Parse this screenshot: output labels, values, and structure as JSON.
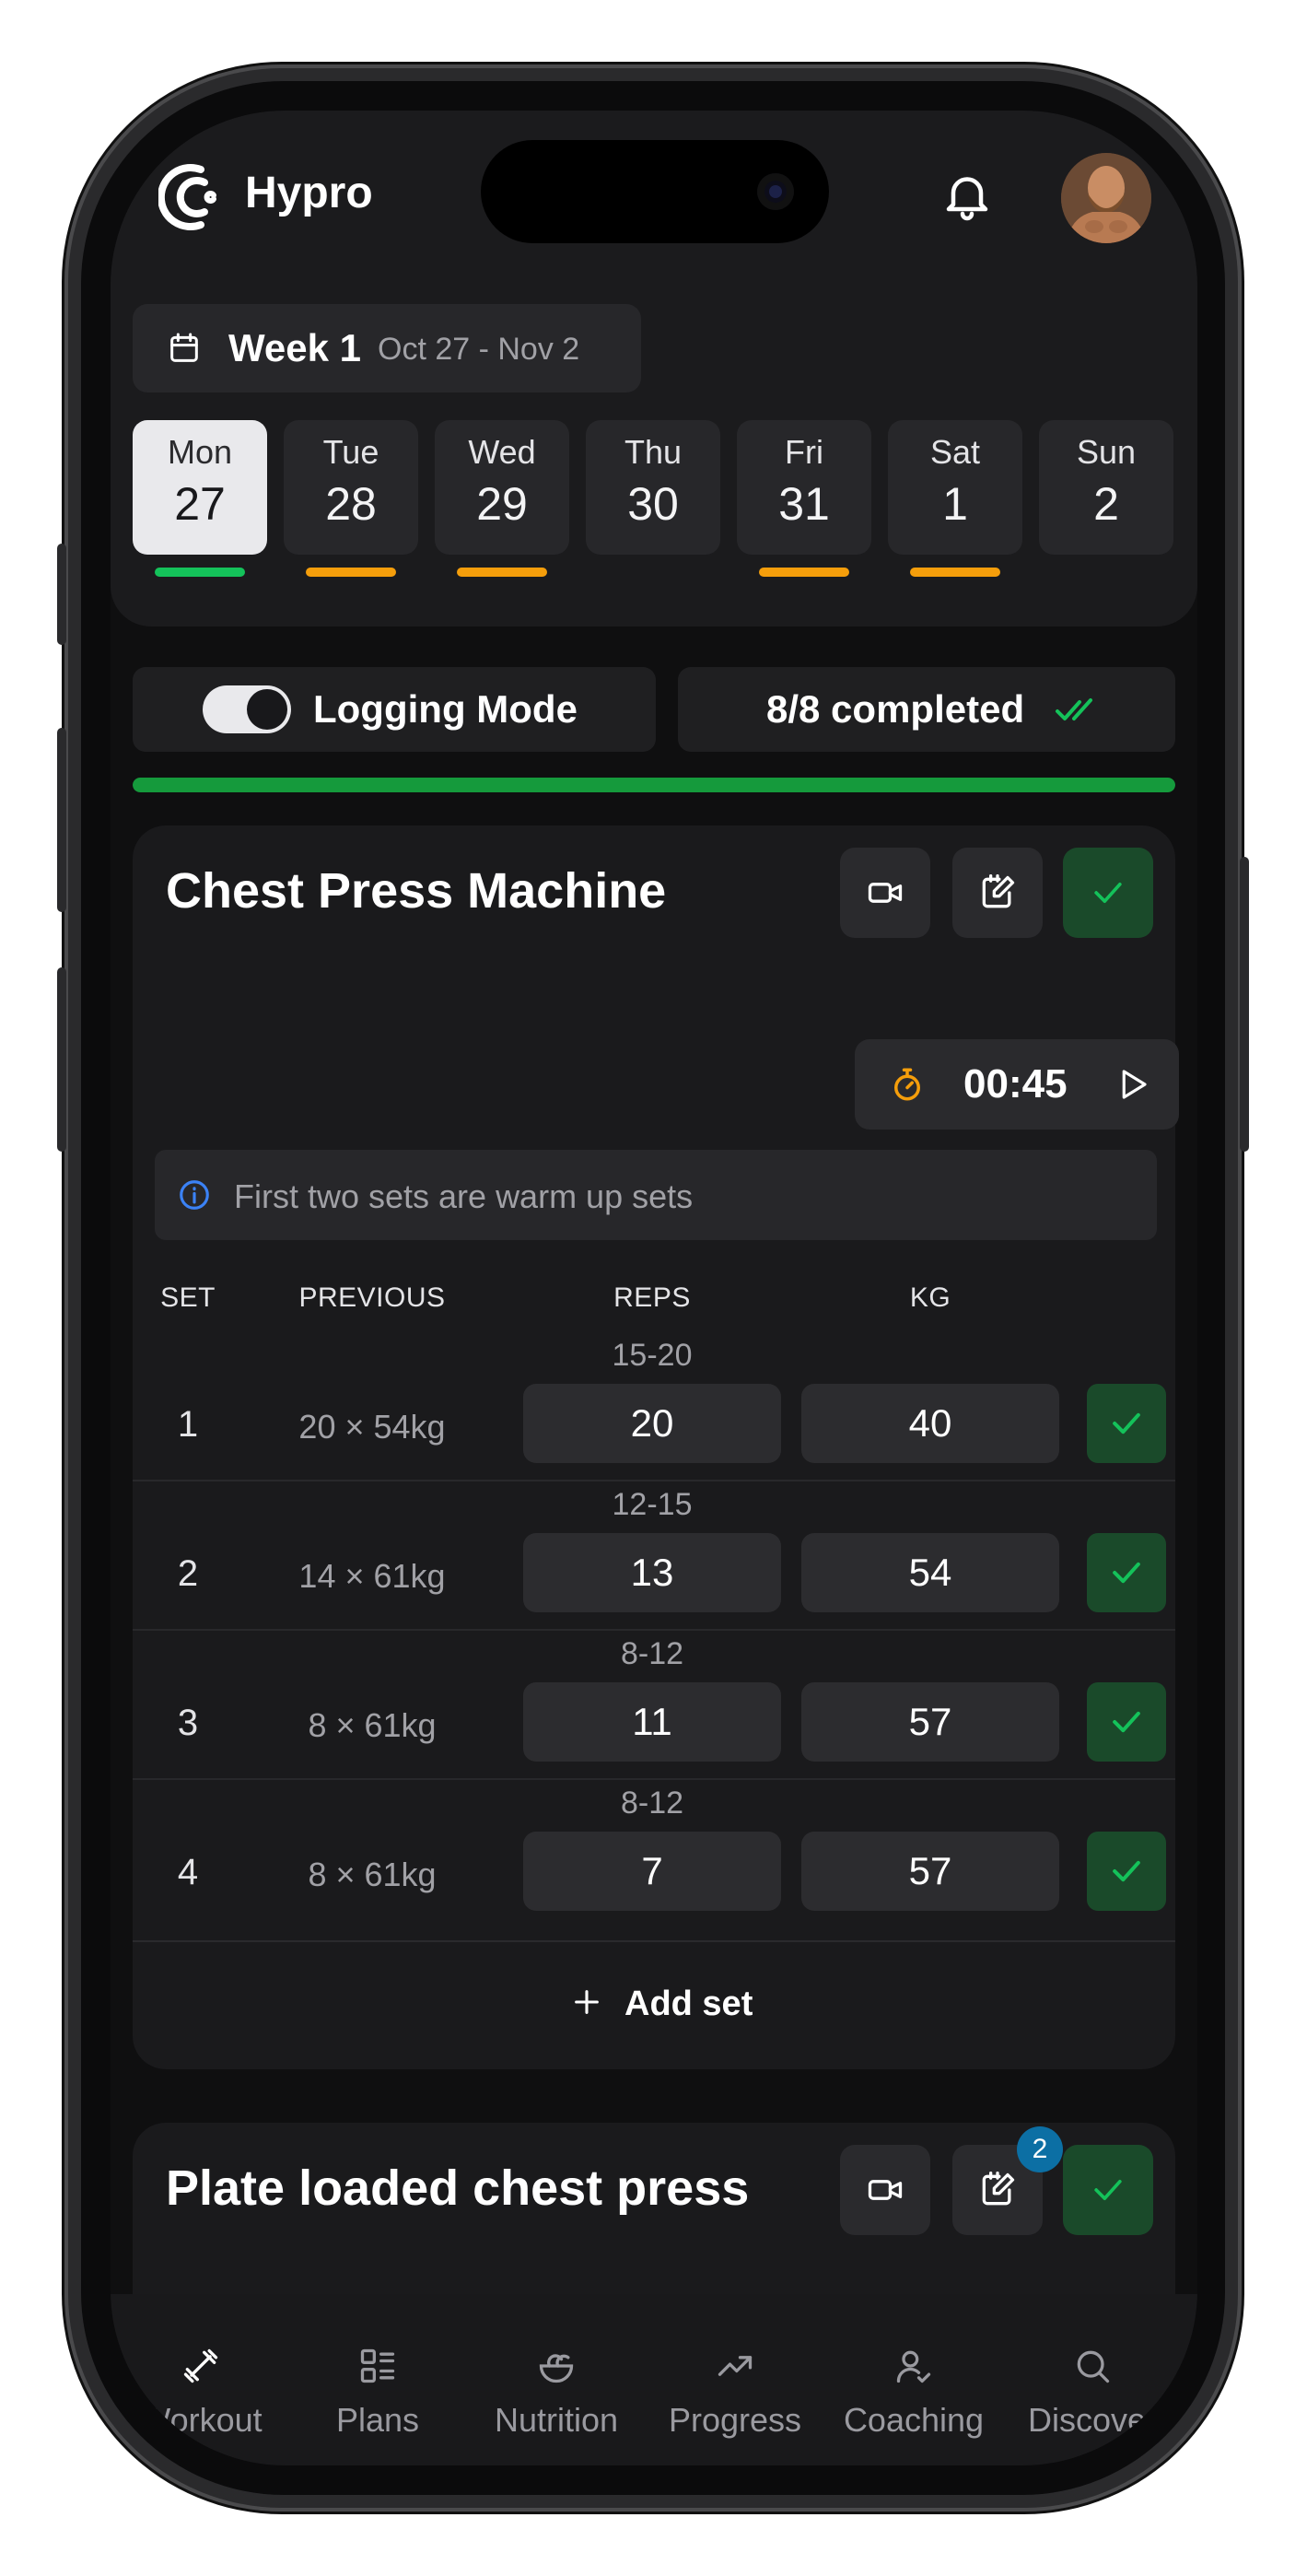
{
  "app": {
    "brand": "Hypro"
  },
  "header": {
    "week_label": "Week 1",
    "week_range": "Oct 27 - Nov 2",
    "days": [
      {
        "name": "Mon",
        "date": "27",
        "active": true,
        "status": "complete"
      },
      {
        "name": "Tue",
        "date": "28",
        "active": false,
        "status": "partial"
      },
      {
        "name": "Wed",
        "date": "29",
        "active": false,
        "status": "partial"
      },
      {
        "name": "Thu",
        "date": "30",
        "active": false,
        "status": "none"
      },
      {
        "name": "Fri",
        "date": "31",
        "active": false,
        "status": "partial"
      },
      {
        "name": "Sat",
        "date": "1",
        "active": false,
        "status": "partial"
      },
      {
        "name": "Sun",
        "date": "2",
        "active": false,
        "status": "none"
      }
    ]
  },
  "colors": {
    "complete": "#14c25a",
    "partial": "#f59e0b",
    "progress": "#159a3c",
    "accent_badge": "#0c6fa4",
    "timer": "#f59e0b",
    "info": "#3b82f6"
  },
  "logging": {
    "label": "Logging Mode",
    "enabled": true
  },
  "completion": {
    "label": "8/8 completed",
    "progress": 1.0
  },
  "exercise1": {
    "title": "Chest Press Machine",
    "timer": "00:45",
    "note": "First two sets are warm up sets",
    "columns": {
      "set": "SET",
      "previous": "PREVIOUS",
      "reps": "REPS",
      "kg": "KG"
    },
    "sets": [
      {
        "num": "1",
        "target": "15-20",
        "previous": "20 × 54kg",
        "reps": "20",
        "kg": "40"
      },
      {
        "num": "2",
        "target": "12-15",
        "previous": "14 × 61kg",
        "reps": "13",
        "kg": "54"
      },
      {
        "num": "3",
        "target": "8-12",
        "previous": "8 × 61kg",
        "reps": "11",
        "kg": "57"
      },
      {
        "num": "4",
        "target": "8-12",
        "previous": "8 × 61kg",
        "reps": "7",
        "kg": "57"
      }
    ],
    "add_set": "Add set"
  },
  "exercise2": {
    "title": "Plate loaded chest press",
    "notes_badge": "2"
  },
  "tabs": [
    {
      "label": "Workout",
      "icon": "dumbbell-icon",
      "active": true
    },
    {
      "label": "Plans",
      "icon": "plans-icon",
      "active": false
    },
    {
      "label": "Nutrition",
      "icon": "nutrition-icon",
      "active": false
    },
    {
      "label": "Progress",
      "icon": "trending-up-icon",
      "active": false
    },
    {
      "label": "Coaching",
      "icon": "coaching-icon",
      "active": false
    },
    {
      "label": "Discover",
      "icon": "search-icon",
      "active": false
    }
  ]
}
